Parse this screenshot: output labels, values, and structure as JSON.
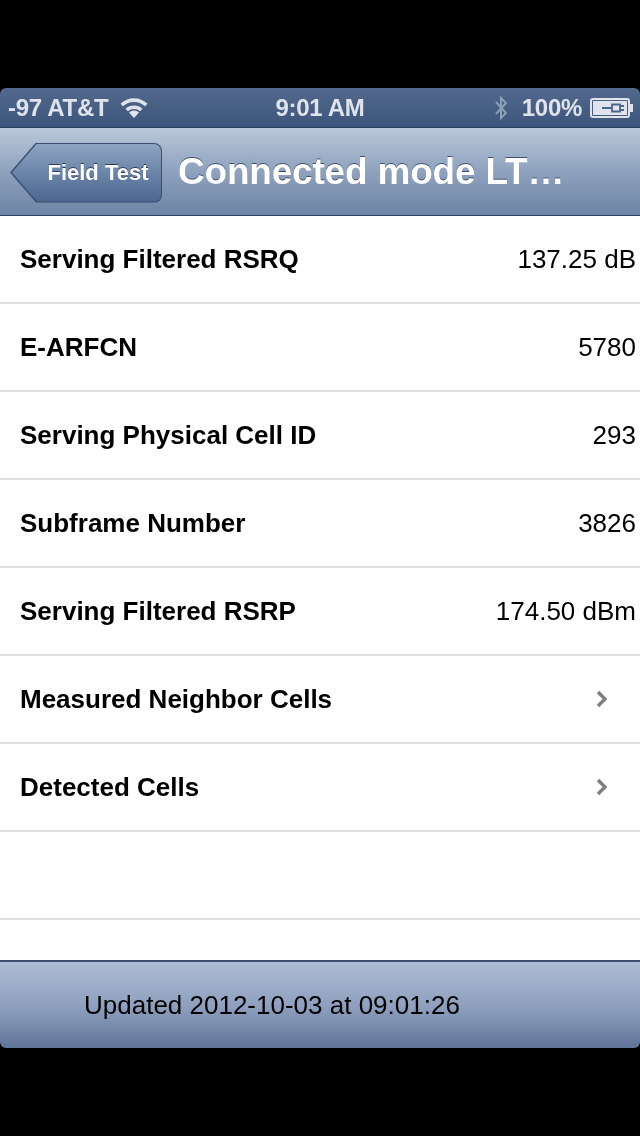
{
  "status_bar": {
    "carrier": "-97 AT&T",
    "time": "9:01 AM",
    "battery": "100%"
  },
  "nav_bar": {
    "back_button": "Field Test",
    "title": "Connected mode LT…"
  },
  "rows": [
    {
      "kind": "value",
      "label": "Serving Filtered RSRQ",
      "value": "137.25 dB"
    },
    {
      "kind": "value",
      "label": "E-ARFCN",
      "value": "5780"
    },
    {
      "kind": "value",
      "label": "Serving Physical Cell ID",
      "value": "293"
    },
    {
      "kind": "value",
      "label": "Subframe Number",
      "value": "3826"
    },
    {
      "kind": "value",
      "label": "Serving Filtered RSRP",
      "value": "174.50 dBm"
    },
    {
      "kind": "disclosure",
      "label": "Measured Neighbor Cells"
    },
    {
      "kind": "disclosure",
      "label": "Detected Cells"
    }
  ],
  "toolbar": {
    "text": "Updated 2012-10-03 at 09:01:26"
  }
}
